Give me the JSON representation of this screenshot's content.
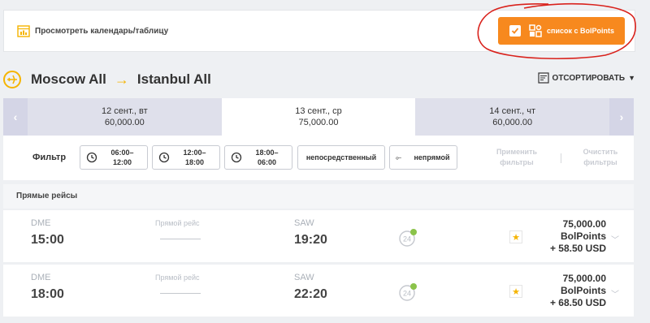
{
  "topbar": {
    "calendar_link": "Просмотреть календарь/таблицу",
    "bolpoints_button": "список с BolPoints"
  },
  "route": {
    "origin": "Moscow All",
    "destination": "Istanbul All",
    "sort_label": "ОТСОРТИРОВАТЬ"
  },
  "dates": [
    {
      "date": "12 сент., вт",
      "price": "60,000.00"
    },
    {
      "date": "13 сент., ср",
      "price": "75,000.00"
    },
    {
      "date": "14 сент., чт",
      "price": "60,000.00"
    }
  ],
  "filters": {
    "label": "Фильтр",
    "time_1": "06:00–\n12:00",
    "time_2": "12:00–\n18:00",
    "time_3": "18:00–\n06:00",
    "direct": "непосредственный",
    "indirect": "непрямой",
    "apply": "Применить\nфильтры",
    "clear": "Очистить\nфильтры"
  },
  "section_title": "Прямые рейсы",
  "flights": [
    {
      "from": "DME",
      "dep": "15:00",
      "via": "Прямой рейс",
      "to": "SAW",
      "arr": "19:20",
      "price": "75,000.00",
      "currency": "BolPoints",
      "extra": "+ 58.50 USD"
    },
    {
      "from": "DME",
      "dep": "18:00",
      "via": "Прямой рейс",
      "to": "SAW",
      "arr": "22:20",
      "price": "75,000.00",
      "currency": "BolPoints",
      "extra": "+ 68.50 USD"
    }
  ],
  "colors": {
    "accent": "#f7891e",
    "highlight": "#f5b400",
    "annotation": "#d9221c"
  }
}
